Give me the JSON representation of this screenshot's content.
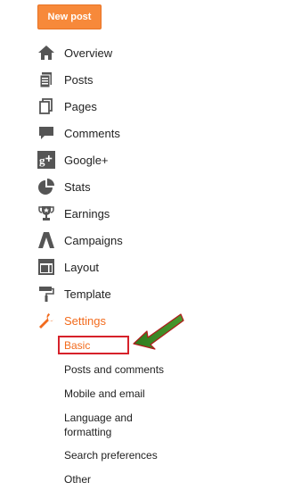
{
  "new_post_label": "New post",
  "nav": {
    "overview": "Overview",
    "posts": "Posts",
    "pages": "Pages",
    "comments": "Comments",
    "google_plus": "Google+",
    "stats": "Stats",
    "earnings": "Earnings",
    "campaigns": "Campaigns",
    "layout": "Layout",
    "template": "Template",
    "settings": "Settings"
  },
  "settings_sub": {
    "basic": "Basic",
    "posts_and_comments": "Posts and comments",
    "mobile_and_email": "Mobile and email",
    "language_line1": "Language and",
    "language_line2": "formatting",
    "search_preferences": "Search preferences",
    "other": "Other"
  },
  "colors": {
    "accent": "#f26b1d",
    "button": "#f7893a",
    "icon": "#555555",
    "highlight_box": "#d6212a",
    "arrow": "#2f7a1f"
  }
}
